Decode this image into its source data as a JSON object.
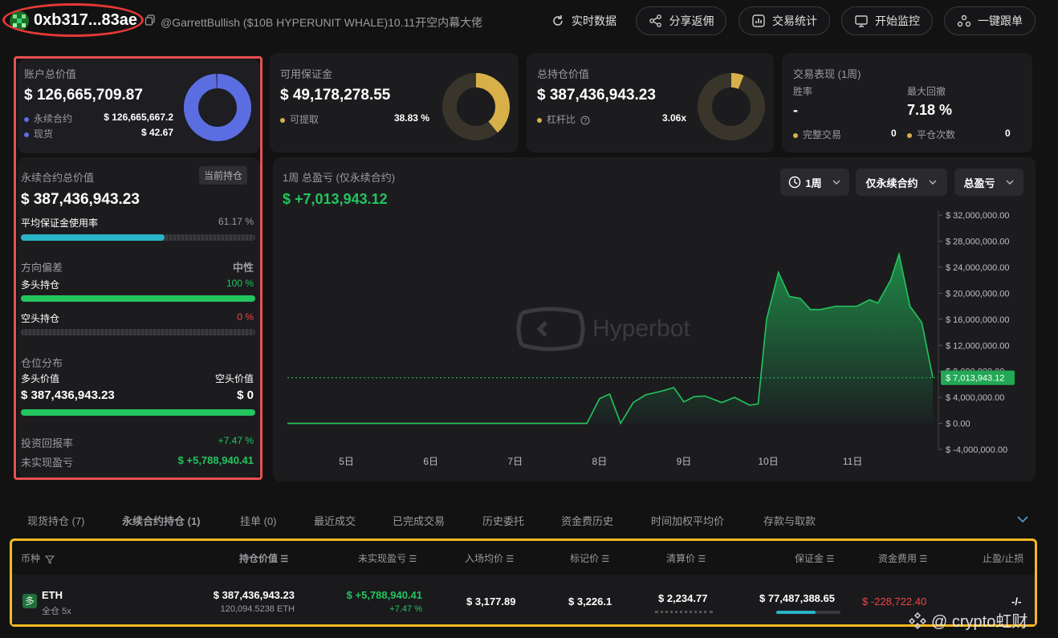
{
  "header": {
    "address": "0xb317...83ae",
    "description": "@GarrettBullish ($10B HYPERUNIT WHALE)10.11开空内幕大佬",
    "buttons": [
      "实时数据",
      "分享返佣",
      "交易统计",
      "开始监控",
      "一键跟单"
    ]
  },
  "account": {
    "title": "账户总价值",
    "value": "$ 126,665,709.87",
    "perp_label": "永续合约",
    "perp_value": "$ 126,665,667.2",
    "spot_label": "现货",
    "spot_value": "$ 42.67",
    "perp_fraction": 0.99
  },
  "margin": {
    "title": "可用保证金",
    "value": "$ 49,178,278.55",
    "withdraw_label": "可提取",
    "withdraw_pct": "38.83 %",
    "fraction": 0.3883
  },
  "position": {
    "title": "总持仓价值",
    "value": "$ 387,436,943.23",
    "leverage_label": "杠杆比",
    "leverage": "3.06x",
    "fraction": 0.06
  },
  "performance": {
    "title": "交易表现 (1周)",
    "winrate_label": "胜率",
    "winrate": "-",
    "drawdown_label": "最大回撤",
    "drawdown": "7.18 %",
    "complete_label": "完整交易",
    "complete": "0",
    "close_label": "平仓次数",
    "close": "0"
  },
  "perp_summary": {
    "title": "永续合约总价值",
    "badge": "当前持仓",
    "value": "$ 387,436,943.23",
    "margin_usage_label": "平均保证金使用率",
    "margin_usage": "61.17 %",
    "margin_usage_fraction": 0.6117,
    "bias_label": "方向偏差",
    "bias": "中性",
    "long_label": "多头持仓",
    "long_pct": "100 %",
    "long_fraction": 1.0,
    "short_label": "空头持仓",
    "short_pct": "0 %",
    "short_fraction": 0.0,
    "dist_label": "仓位分布",
    "long_value_label": "多头价值",
    "short_value_label": "空头价值",
    "long_value": "$ 387,436,943.23",
    "short_value": "$ 0",
    "roi_label": "投资回报率",
    "roi": "+7.47 %",
    "upnl_label": "未实现盈亏",
    "upnl": "$ +5,788,940.41"
  },
  "chart_panel": {
    "title": "1周 总盈亏 (仅永续合约)",
    "total": "$ +7,013,943.12",
    "dropdowns": [
      "1周",
      "仅永续合约",
      "总盈亏"
    ],
    "watermark": "Hyperbot",
    "current_label": "$ 7,013,943.12"
  },
  "chart_data": {
    "type": "area",
    "x_ticks": [
      "5日",
      "6日",
      "7日",
      "8日",
      "9日",
      "10日",
      "11日"
    ],
    "y_ticks": [
      "$ 32,000,000.00",
      "$ 28,000,000.00",
      "$ 24,000,000.00",
      "$ 20,000,000.00",
      "$ 16,000,000.00",
      "$ 12,000,000.00",
      "$ 8,000,000.00",
      "$ 4,000,000.00",
      "$ 0.00",
      "$ -4,000,000.00"
    ],
    "y_values": [
      32000000,
      28000000,
      24000000,
      20000000,
      16000000,
      12000000,
      8000000,
      4000000,
      0,
      -4000000
    ],
    "ylim": [
      -4000000,
      33000000
    ],
    "xlim": [
      4.3,
      11.55
    ],
    "series": [
      {
        "points": [
          [
            4.3,
            0
          ],
          [
            7.85,
            0
          ],
          [
            8.0,
            3800000
          ],
          [
            8.12,
            4500000
          ],
          [
            8.25,
            0
          ],
          [
            8.4,
            3200000
          ],
          [
            8.55,
            4400000
          ],
          [
            8.75,
            5000000
          ],
          [
            8.88,
            5500000
          ],
          [
            9.0,
            3300000
          ],
          [
            9.12,
            4100000
          ],
          [
            9.25,
            4200000
          ],
          [
            9.45,
            3200000
          ],
          [
            9.6,
            4000000
          ],
          [
            9.78,
            2800000
          ],
          [
            9.88,
            3000000
          ],
          [
            9.98,
            16000000
          ],
          [
            10.12,
            23200000
          ],
          [
            10.25,
            19500000
          ],
          [
            10.38,
            19200000
          ],
          [
            10.5,
            17500000
          ],
          [
            10.62,
            17500000
          ],
          [
            10.8,
            18000000
          ],
          [
            11.05,
            18000000
          ],
          [
            11.2,
            19000000
          ],
          [
            11.3,
            18500000
          ],
          [
            11.45,
            22000000
          ],
          [
            11.55,
            26000000
          ],
          [
            11.68,
            18000000
          ],
          [
            11.82,
            15500000
          ],
          [
            11.95,
            7013943
          ]
        ]
      }
    ],
    "current_value": 7013943.12
  },
  "tabs": [
    "现货持仓 (7)",
    "永续合约持仓 (1)",
    "挂单 (0)",
    "最近成交",
    "已完成交易",
    "历史委托",
    "资金费历史",
    "时间加权平均价",
    "存款与取款"
  ],
  "table": {
    "headers": [
      "币种",
      "持仓价值",
      "未实现盈亏",
      "入场均价",
      "标记价",
      "清算价",
      "保证金",
      "资金费用",
      "止盈/止损"
    ],
    "row": {
      "side": "多",
      "coin": "ETH",
      "mode": "全仓 5x",
      "value": "$ 387,436,943.23",
      "size": "120,094.5238 ETH",
      "upnl": "$ +5,788,940.41",
      "upnl_pct": "+7.47 %",
      "entry": "$ 3,177.89",
      "mark": "$ 3,226.1",
      "liq": "$ 2,234.77",
      "margin": "$ 77,487,388.65",
      "funding": "$ -228,722.40",
      "tpsl": "-/-"
    }
  },
  "watermark": "@ crypto虹财"
}
